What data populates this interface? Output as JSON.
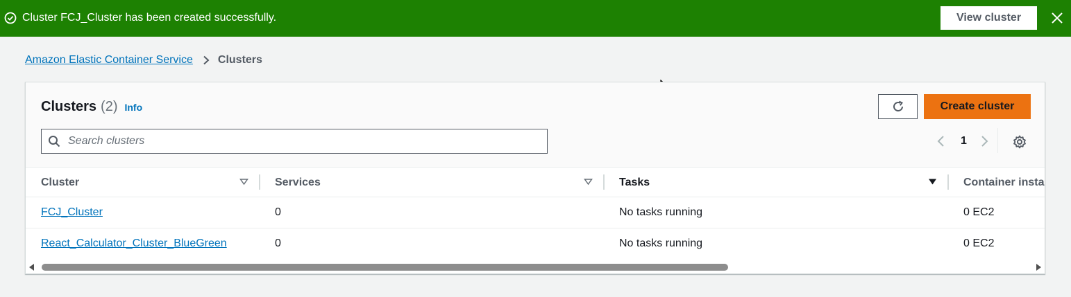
{
  "flash": {
    "message": "Cluster FCJ_Cluster has been created successfully.",
    "view_button": "View cluster",
    "color": "#1d8102"
  },
  "breadcrumb": {
    "items": [
      {
        "label": "Amazon Elastic Container Service"
      },
      {
        "label": "Clusters"
      }
    ]
  },
  "header": {
    "title": "Clusters",
    "count": "(2)",
    "info": "Info",
    "create_button": "Create cluster",
    "accent": "#ec7211"
  },
  "search": {
    "placeholder": "Search clusters",
    "value": ""
  },
  "pagination": {
    "current_page": "1"
  },
  "table": {
    "columns": [
      {
        "label": "Cluster"
      },
      {
        "label": "Services"
      },
      {
        "label": "Tasks"
      },
      {
        "label": "Container instan"
      }
    ],
    "rows": [
      {
        "cluster": "FCJ_Cluster",
        "services": "0",
        "tasks": "No tasks running",
        "container_instances": "0 EC2"
      },
      {
        "cluster": "React_Calculator_Cluster_BlueGreen",
        "services": "0",
        "tasks": "No tasks running",
        "container_instances": "0 EC2"
      }
    ]
  },
  "icons": {
    "flash_status": "check-circle-icon",
    "flash_close": "close-icon",
    "breadcrumb_sep": "chevron-right-icon",
    "refresh": "refresh-icon",
    "search": "search-icon",
    "prev": "chevron-left-icon",
    "next": "chevron-right-icon",
    "settings": "gear-icon"
  }
}
